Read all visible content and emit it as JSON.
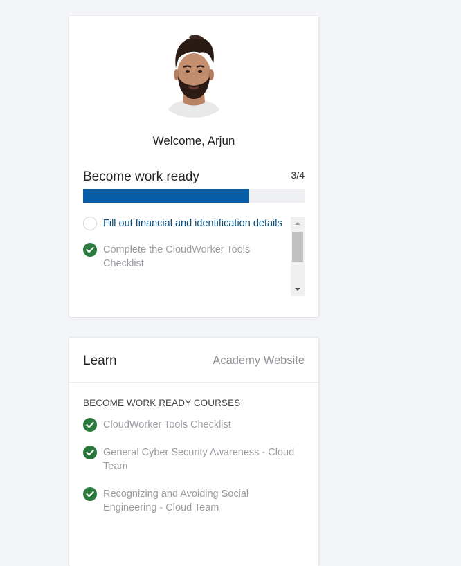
{
  "profile": {
    "welcome_text": "Welcome, Arjun",
    "avatar_icon": "user-photo"
  },
  "work_ready": {
    "title": "Become work ready",
    "progress_text": "3/4",
    "progress_fraction": 0.75,
    "accent_color": "#075ca6",
    "tasks": [
      {
        "label": "Fill out financial and identification details",
        "status": "pending"
      },
      {
        "label": "Complete the CloudWorker Tools Checklist",
        "status": "done"
      }
    ]
  },
  "learn": {
    "title": "Learn",
    "link_label": "Academy Website",
    "courses_heading": "BECOME WORK READY COURSES",
    "courses": [
      {
        "label": "CloudWorker Tools Checklist",
        "status": "done"
      },
      {
        "label": "General Cyber Security Awareness - Cloud Team",
        "status": "done"
      },
      {
        "label": "Recognizing and Avoiding Social Engineering - Cloud Team",
        "status": "done"
      }
    ],
    "done_color": "#2a7a3e"
  }
}
